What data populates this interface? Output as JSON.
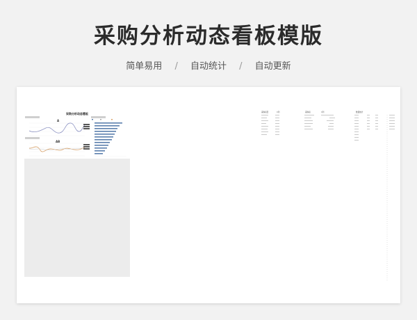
{
  "page": {
    "title": "采购分析动态看板模版",
    "features": [
      "简单易用",
      "自动统计",
      "自动更新"
    ],
    "separator": "/"
  },
  "dashboard": {
    "title": "采购分析动态看板",
    "chart_a_label": "A",
    "chart_b_label": "AB",
    "legend_items": [
      "A类",
      "A类合同金额",
      "A类合同利率"
    ]
  },
  "sheet_headers": {
    "col1": "采购项目",
    "col2": "C列",
    "col3": "采购项",
    "col4": "C列",
    "col5": "数量统计"
  },
  "colors": {
    "line_a": "#8f95c4",
    "line_b": "#d9a36b",
    "bars": "#5b7fad"
  }
}
